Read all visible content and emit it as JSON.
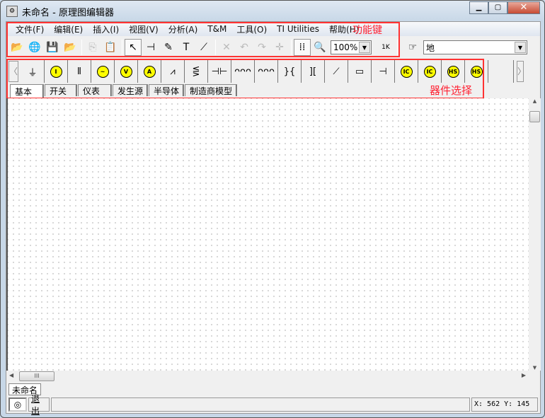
{
  "window": {
    "title": "未命名 - 原理图编辑器",
    "controls": [
      "minimize",
      "maximize",
      "close"
    ]
  },
  "menu": [
    "文件(F)",
    "编辑(E)",
    "插入(I)",
    "视图(V)",
    "分析(A)",
    "T&M",
    "工具(O)",
    "TI Utilities",
    "帮助(H)"
  ],
  "annotations": {
    "function_keys": "功能键",
    "component_select": "器件选择"
  },
  "toolbar": {
    "buttons": [
      {
        "name": "open-icon",
        "glyph": "📂",
        "state": "normal"
      },
      {
        "name": "web-search-icon",
        "glyph": "🌐",
        "state": "normal"
      },
      {
        "name": "save-icon",
        "glyph": "💾",
        "state": "normal"
      },
      {
        "name": "open-recent-icon",
        "glyph": "📂",
        "state": "normal"
      },
      {
        "name": "sep"
      },
      {
        "name": "copy-icon",
        "glyph": "⎘",
        "state": "disabled"
      },
      {
        "name": "paste-icon",
        "glyph": "📋",
        "state": "disabled"
      },
      {
        "name": "sep"
      },
      {
        "name": "pointer-icon",
        "glyph": "↖",
        "state": "active"
      },
      {
        "name": "wire-icon",
        "glyph": "⊣",
        "state": "normal"
      },
      {
        "name": "pencil-icon",
        "glyph": "✎",
        "state": "normal"
      },
      {
        "name": "text-icon",
        "glyph": "T",
        "state": "normal"
      },
      {
        "name": "line-tool-icon",
        "glyph": "⟋",
        "state": "normal"
      },
      {
        "name": "sep"
      },
      {
        "name": "delete-icon",
        "glyph": "✕",
        "state": "disabled"
      },
      {
        "name": "undo-icon",
        "glyph": "↶",
        "state": "disabled"
      },
      {
        "name": "redo-icon",
        "glyph": "↷",
        "state": "disabled"
      },
      {
        "name": "junction-icon",
        "glyph": "✛",
        "state": "disabled"
      },
      {
        "name": "sep"
      },
      {
        "name": "grid-icon",
        "glyph": "⁞⁞",
        "state": "active"
      },
      {
        "name": "zoom-icon",
        "glyph": "🔍",
        "state": "normal"
      }
    ],
    "zoom_value": "100%",
    "component_value_icon": "resistor-value-icon",
    "component_value_label": "1K",
    "component_search_value": "地"
  },
  "components": [
    {
      "name": "ground",
      "glyph": "⏚"
    },
    {
      "name": "dc-current-source",
      "glyph": "I"
    },
    {
      "name": "battery",
      "glyph": "⫴"
    },
    {
      "name": "ac-source",
      "glyph": "~"
    },
    {
      "name": "voltmeter",
      "glyph": "V"
    },
    {
      "name": "ammeter",
      "glyph": "A"
    },
    {
      "name": "resistor",
      "glyph": "⩘"
    },
    {
      "name": "potentiometer",
      "glyph": "⋚"
    },
    {
      "name": "capacitor",
      "glyph": "⊣⊢"
    },
    {
      "name": "inductor",
      "glyph": "ᴖᴖᴖ"
    },
    {
      "name": "variable-inductor",
      "glyph": "ᴖᴖᴖ"
    },
    {
      "name": "coupled-inductor",
      "glyph": "}{"
    },
    {
      "name": "transformer",
      "glyph": "]["
    },
    {
      "name": "switch",
      "glyph": "⟋"
    },
    {
      "name": "thermistor",
      "glyph": "▭"
    },
    {
      "name": "electrode",
      "glyph": "⊣"
    },
    {
      "name": "ic-source",
      "glyph": "IC"
    },
    {
      "name": "ic-source-plus",
      "glyph": "IC"
    },
    {
      "name": "hs-source",
      "glyph": "HS"
    },
    {
      "name": "hs-source-plus",
      "glyph": "HS"
    }
  ],
  "yellow_components": [
    "dc-current-source",
    "ac-source",
    "voltmeter",
    "ammeter",
    "ic-source",
    "ic-source-plus",
    "hs-source",
    "hs-source-plus"
  ],
  "component_tabs": [
    "基本",
    "开关",
    "仪表",
    "发生源",
    "半导体",
    "制造商模型"
  ],
  "document_tab": "未命名",
  "status": {
    "exit_label": "退出",
    "coords": "X: 562  Y: 145"
  },
  "colors": {
    "annotation": "#ff3333",
    "component_yellow": "#ffff00"
  }
}
